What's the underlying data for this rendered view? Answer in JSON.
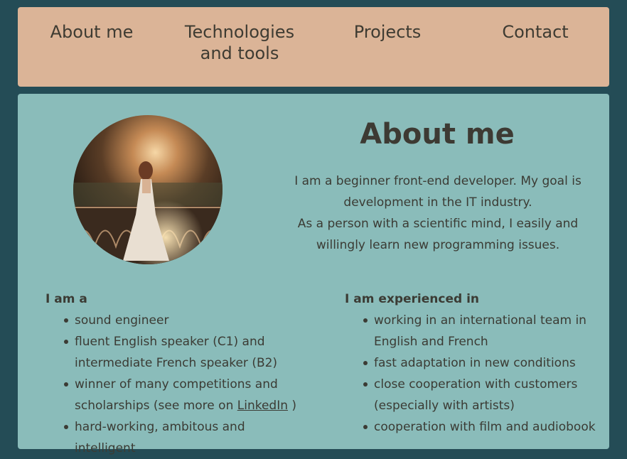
{
  "nav": {
    "items": [
      {
        "label": "About me"
      },
      {
        "label": "Technologies and tools"
      },
      {
        "label": "Projects"
      },
      {
        "label": "Contact"
      }
    ]
  },
  "about": {
    "title": "About me",
    "intro_line1": "I am a beginner front-end developer. My goal is development in the IT industry.",
    "intro_line2": "As a person with a scientific mind, I easily and willingly learn new programming issues."
  },
  "left_column": {
    "heading": "I am a",
    "items": [
      "sound engineer",
      "fluent English speaker (C1) and intermediate French speaker (B2)",
      "hard-working, ambitous and intelligent"
    ],
    "item_link": {
      "before": "winner of many competitions and scholarships (see more on ",
      "link": "LinkedIn",
      "after": " )"
    }
  },
  "right_column": {
    "heading": "I am experienced in",
    "items": [
      "working in an international team in English and French",
      "fast adaptation in new conditions",
      "close cooperation with customers (especially with artists)",
      "cooperation with film and audiobook"
    ]
  },
  "colors": {
    "background": "#244c56",
    "nav": "#dbb497",
    "card": "#8abcba",
    "text": "#3b3b34"
  }
}
